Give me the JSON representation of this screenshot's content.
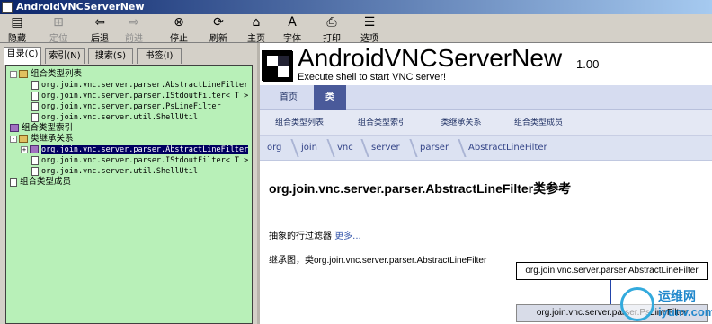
{
  "window": {
    "title": "AndroidVNCServerNew"
  },
  "toolbar": [
    {
      "label": "隐藏",
      "icon": "hide-icon",
      "enabled": true
    },
    {
      "label": "定位",
      "icon": "locate-icon",
      "enabled": false
    },
    {
      "label": "后退",
      "icon": "back-icon",
      "enabled": true
    },
    {
      "label": "前进",
      "icon": "forward-icon",
      "enabled": false
    },
    {
      "label": "停止",
      "icon": "stop-icon",
      "enabled": true
    },
    {
      "label": "刷新",
      "icon": "refresh-icon",
      "enabled": true
    },
    {
      "label": "主页",
      "icon": "home-icon",
      "enabled": true
    },
    {
      "label": "字体",
      "icon": "font-icon",
      "enabled": true
    },
    {
      "label": "打印",
      "icon": "print-icon",
      "enabled": true
    },
    {
      "label": "选项(O)",
      "icon": "options-icon",
      "enabled": true
    }
  ],
  "tabs": [
    "目录(C)",
    "索引(N)",
    "搜索(S)",
    "书签(I)"
  ],
  "tree": [
    {
      "text": "组合类型列表",
      "icon": "book",
      "indent": 0,
      "expander": "-"
    },
    {
      "text": "org.join.vnc.server.parser.AbstractLineFilter",
      "icon": "doc",
      "indent": 2
    },
    {
      "text": "org.join.vnc.server.parser.IStdoutFilter< T >",
      "icon": "doc",
      "indent": 2
    },
    {
      "text": "org.join.vnc.server.parser.PsLineFilter",
      "icon": "doc",
      "indent": 2
    },
    {
      "text": "org.join.vnc.server.util.ShellUtil",
      "icon": "doc",
      "indent": 2
    },
    {
      "text": "组合类型索引",
      "icon": "book-purple",
      "indent": 0
    },
    {
      "text": "类继承关系",
      "icon": "book",
      "indent": 0,
      "expander": "-"
    },
    {
      "text": "org.join.vnc.server.parser.AbstractLineFilter",
      "icon": "book-purple",
      "indent": 1,
      "expander": "+",
      "selected": true
    },
    {
      "text": "org.join.vnc.server.parser.IStdoutFilter< T >",
      "icon": "doc",
      "indent": 2
    },
    {
      "text": "org.join.vnc.server.util.ShellUtil",
      "icon": "doc",
      "indent": 2
    },
    {
      "text": "组合类型成员",
      "icon": "doc",
      "indent": 0
    }
  ],
  "doc": {
    "project_name": "AndroidVNCServerNew",
    "version": "1.00",
    "brief": "Execute shell to start VNC server!",
    "nav_main": [
      "首页",
      "类"
    ],
    "nav_sub": [
      "组合类型列表",
      "组合类型索引",
      "类继承关系",
      "组合类型成员"
    ],
    "breadcrumb": [
      "org",
      "join",
      "vnc",
      "server",
      "parser",
      "AbstractLineFilter"
    ],
    "heading": "org.join.vnc.server.parser.AbstractLineFilter类参考",
    "description": "抽象的行过滤器",
    "more_link": "更多...",
    "inheritance_label": "继承图，类org.join.vnc.server.parser.AbstractLineFilter",
    "diagram_base": "org.join.vnc.server.parser.AbstractLineFilter",
    "diagram_derived": "org.join.vnc.server.parser.PsLineFilter"
  },
  "watermark": {
    "line1": "运维网",
    "line2": "iyunv.com"
  },
  "colors": {
    "tree_bg": "#b8f0b8",
    "nav_active": "#4a5a9a",
    "title_bar": "#0a246a"
  }
}
